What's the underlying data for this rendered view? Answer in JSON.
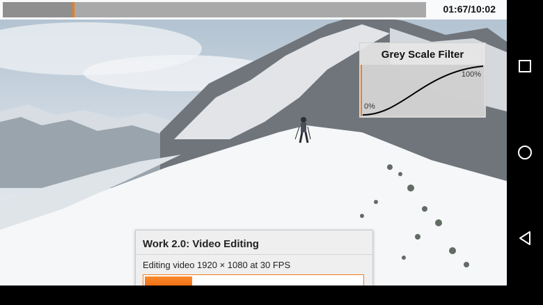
{
  "timeline": {
    "position_text": "01:67/10:02",
    "played_fraction": 0.165,
    "accent_color": "#f07b1a"
  },
  "filter_panel": {
    "title": "Grey Scale Filter",
    "min_label": "0%",
    "max_label": "100%",
    "curve_color": "#000000",
    "marker_color": "#f07b1a"
  },
  "task_panel": {
    "title": "Work 2.0: Video Editing",
    "status": "Editing video 1920 × 1080 at 30 FPS",
    "progress_fraction": 0.22,
    "accent_color": "#f07b1a"
  },
  "nav_bar": {
    "recents_icon": "square-icon",
    "home_icon": "circle-icon",
    "back_icon": "triangle-back-icon"
  },
  "scene": {
    "description_icon": "snowy-mountain-video-frame"
  }
}
